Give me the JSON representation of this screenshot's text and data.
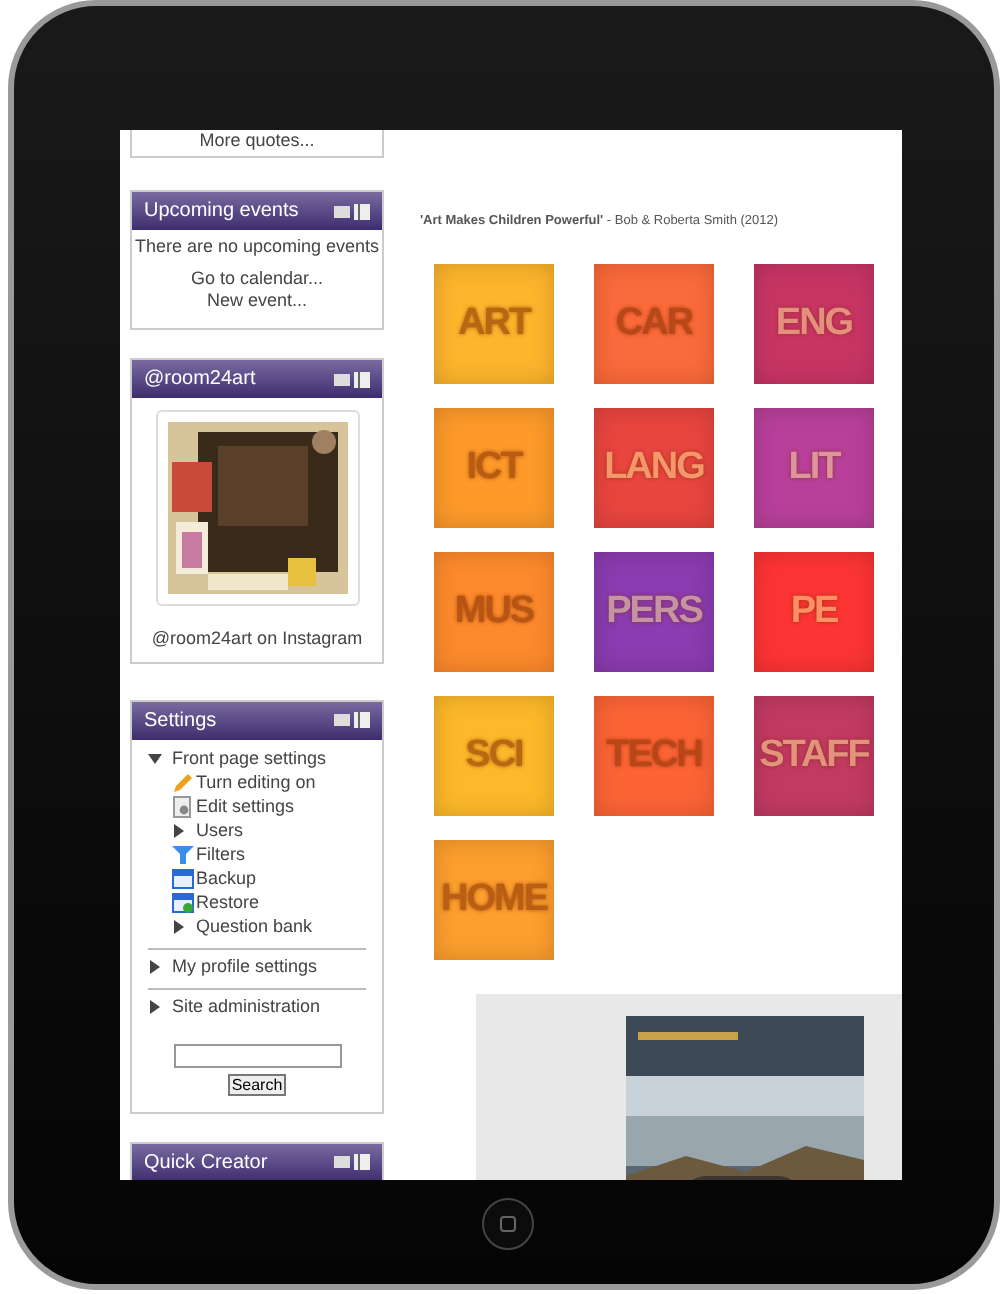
{
  "blocks": [
    {
      "kind": "quotes",
      "links": [
        "More quotes..."
      ]
    },
    {
      "kind": "events",
      "title": "Upcoming events",
      "message": "There are no upcoming events",
      "links": [
        "Go to calendar...",
        "New event..."
      ]
    },
    {
      "kind": "instagram",
      "title": "@room24art",
      "caption": "@room24art on Instagram"
    },
    {
      "kind": "settings",
      "title": "Settings",
      "tree": [
        {
          "label": "Front page settings",
          "kind": "branch",
          "expanded": true,
          "children": [
            {
              "label": "Turn editing on",
              "kind": "pencil"
            },
            {
              "label": "Edit settings",
              "kind": "page"
            },
            {
              "label": "Users",
              "kind": "branch",
              "expanded": false
            },
            {
              "label": "Filters",
              "kind": "filter"
            },
            {
              "label": "Backup",
              "kind": "backup"
            },
            {
              "label": "Restore",
              "kind": "restore"
            },
            {
              "label": "Question bank",
              "kind": "branch",
              "expanded": false
            }
          ]
        },
        {
          "label": "My profile settings",
          "kind": "branch",
          "expanded": false
        },
        {
          "label": "Site administration",
          "kind": "branch",
          "expanded": false
        }
      ],
      "search_button": "Search"
    },
    {
      "kind": "header_only",
      "title": "Quick Creator"
    }
  ],
  "quote": {
    "title": "'Art Makes Children Powerful'",
    "byline": " - Bob & Roberta Smith (2012)"
  },
  "tiles": [
    {
      "label": "ART",
      "color": "#fdb52c"
    },
    {
      "label": "CAR",
      "color": "#fb6a3a"
    },
    {
      "label": "ENG",
      "color": "#c83565"
    },
    {
      "label": "ICT",
      "color": "#fd9a2a"
    },
    {
      "label": "LANG",
      "color": "#e9453f"
    },
    {
      "label": "LIT",
      "color": "#b8409a"
    },
    {
      "label": "MUS",
      "color": "#fd8a2c"
    },
    {
      "label": "PERS",
      "color": "#8b3cb0"
    },
    {
      "label": "PE",
      "color": "#fd3434"
    },
    {
      "label": "SCI",
      "color": "#fdb92a"
    },
    {
      "label": "TECH",
      "color": "#fc6436"
    },
    {
      "label": "STAFF",
      "color": "#c23a62"
    },
    {
      "label": "HOME",
      "color": "#fd9f2e"
    }
  ]
}
